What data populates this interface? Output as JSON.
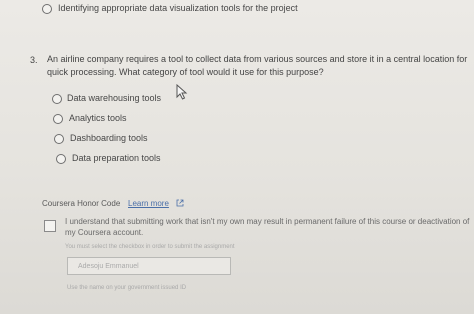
{
  "prev_question": {
    "option_text": "Identifying appropriate data visualization tools for the project"
  },
  "question": {
    "number": "3.",
    "text": "An airline company requires a tool to collect data from various sources and store it in a central location for quick processing. What category of tool would it use for this purpose?",
    "options": [
      "Data warehousing tools",
      "Analytics tools",
      "Dashboarding tools",
      "Data preparation tools"
    ]
  },
  "honor_code": {
    "title": "Coursera Honor Code",
    "link_text": "Learn more",
    "acknowledgement": "I understand that submitting work that isn't my own may result in permanent failure of this course or deactivation of my Coursera account.",
    "hint": "You must select the checkbox in order to submit the assignment",
    "name_value": "Adesoju Emmanuel",
    "name_hint": "Use the name on your government issued ID"
  },
  "colors": {
    "link": "#4a6fa8",
    "text": "#444444"
  }
}
